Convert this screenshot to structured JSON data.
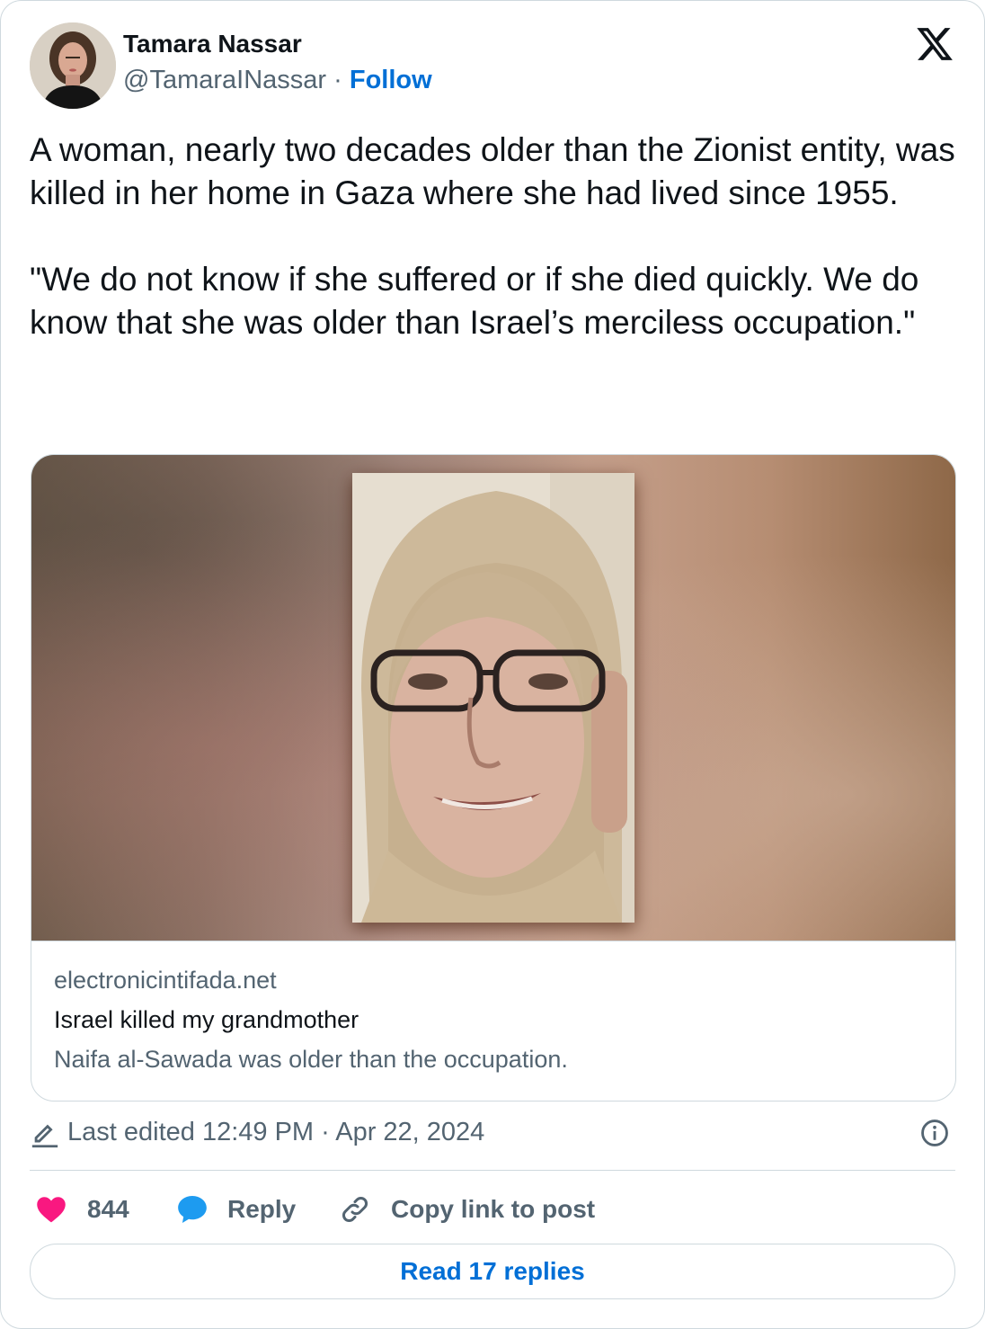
{
  "author": {
    "name": "Tamara Nassar",
    "handle": "@TamaraINassar",
    "separator": "·",
    "follow_label": "Follow"
  },
  "tweet": {
    "text": "A woman, nearly two decades older than the Zionist entity, was killed in her home in Gaza where she had lived since 1955.\n\n\"We do not know if she suffered or if she died quickly. We do know that she was older than Israel’s merciless occupation.\""
  },
  "link_card": {
    "domain": "electronicintifada.net",
    "title": "Israel killed my grandmother",
    "description": "Naifa al-Sawada was older than the occupation."
  },
  "meta": {
    "edited": "Last edited 12:49 PM · Apr 22, 2024"
  },
  "actions": {
    "likes": "844",
    "reply_label": "Reply",
    "copy_label": "Copy link to post"
  },
  "read_replies_label": "Read 17 replies",
  "colors": {
    "link_blue": "#006fd6",
    "like_pink": "#f91880",
    "reply_blue": "#1d9bf0",
    "muted_gray": "#536471",
    "border": "#cfd9de"
  }
}
